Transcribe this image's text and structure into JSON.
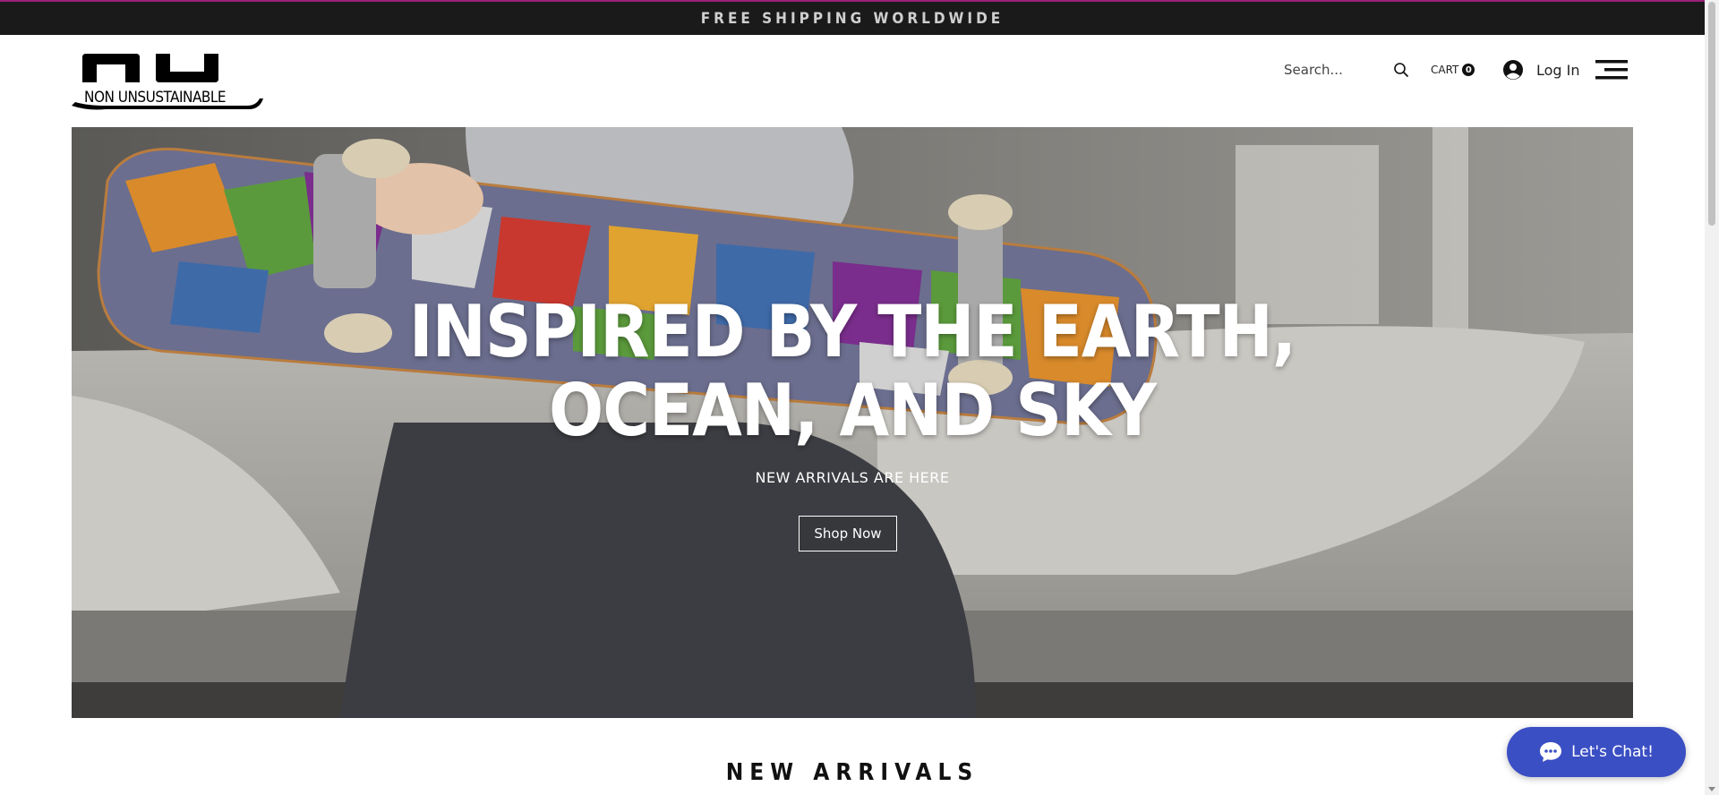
{
  "promo": {
    "text": "FREE SHIPPING WORLDWIDE"
  },
  "logo": {
    "mark": "nu",
    "name": "NON UNSUSTAINABLE"
  },
  "search": {
    "placeholder": "Search..."
  },
  "cart": {
    "label": "CART",
    "count": "0"
  },
  "login": {
    "label": "Log In"
  },
  "hero": {
    "title_line1": "INSPIRED BY THE EARTH,",
    "title_line2": "OCEAN, AND SKY",
    "subtitle": "NEW ARRIVALS ARE HERE",
    "cta_label": "Shop Now"
  },
  "sections": {
    "new_arrivals_title": "NEW ARRIVALS"
  },
  "chat": {
    "label": "Let's Chat!"
  },
  "colors": {
    "promo_bg": "#1a1a1a",
    "promo_border": "#9b1f7a",
    "chat_bg": "#3b4fc4"
  },
  "icons": [
    "search-icon",
    "avatar-icon",
    "hamburger-menu-icon",
    "chat-bubble-icon"
  ]
}
